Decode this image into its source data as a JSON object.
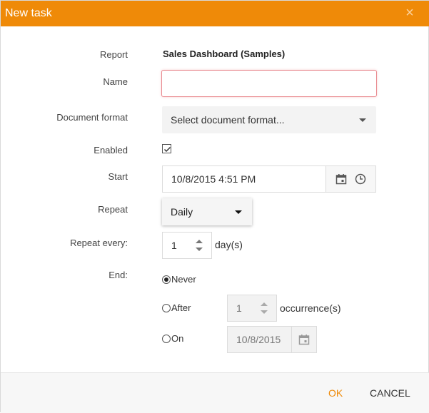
{
  "dialog": {
    "title": "New task",
    "close_glyph": "×"
  },
  "form": {
    "report": {
      "label": "Report",
      "value": "Sales Dashboard (Samples)"
    },
    "name": {
      "label": "Name",
      "value": ""
    },
    "document_format": {
      "label": "Document format",
      "value": "Select document format..."
    },
    "enabled": {
      "label": "Enabled",
      "checked": true
    },
    "start": {
      "label": "Start",
      "value": "10/8/2015 4:51 PM"
    },
    "repeat": {
      "label": "Repeat",
      "value": "Daily"
    },
    "repeat_every": {
      "label": "Repeat every:",
      "value": "1",
      "unit": "day(s)"
    },
    "end": {
      "label": "End:",
      "selected": "Never",
      "options": {
        "never": "Never",
        "after": "After",
        "on": "On"
      },
      "after_value": "1",
      "after_unit": "occurrence(s)",
      "on_value": "10/8/2015"
    }
  },
  "footer": {
    "ok_label": "OK",
    "cancel_label": "CANCEL"
  },
  "colors": {
    "accent": "#ef8a08",
    "invalid_border": "#e98b91"
  },
  "icons": [
    "close-icon",
    "calendar-icon",
    "clock-icon",
    "chevron-down-icon",
    "spinner-up-icon",
    "spinner-down-icon"
  ]
}
